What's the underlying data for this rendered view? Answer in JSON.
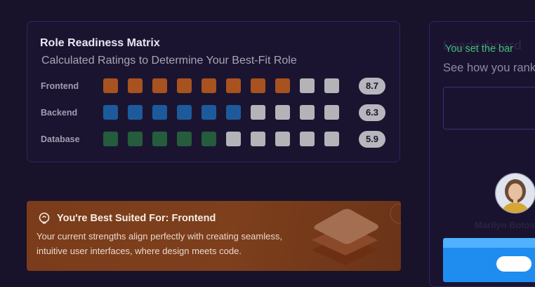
{
  "matrix": {
    "title": "Role Readiness Matrix",
    "subtitle": "Calculated Ratings to Determine Your Best-Fit Role",
    "empty_color": "#b4b3b8",
    "rows": [
      {
        "label": "Frontend",
        "score": "8.7",
        "filled": 8,
        "total": 10,
        "color": "#a7521f"
      },
      {
        "label": "Backend",
        "score": "6.3",
        "filled": 6,
        "total": 10,
        "color": "#1d5a9c"
      },
      {
        "label": "Database",
        "score": "5.9",
        "filled": 5,
        "total": 10,
        "color": "#245c3c"
      }
    ]
  },
  "suited": {
    "heading": "You're Best Suited For: Frontend",
    "desc_line1": "Your current strengths align perfectly with creating seamless,",
    "desc_line2": "intuitive user interfaces, where design meets code."
  },
  "leaderboard": {
    "title": "Leaderboard",
    "subtitle": "See how you rank",
    "note": "You set the bar",
    "top_name": "Marilyn Botosh"
  }
}
